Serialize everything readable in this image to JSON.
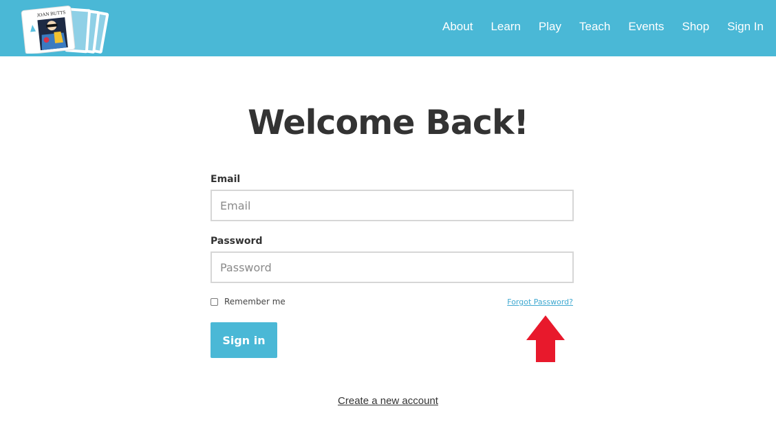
{
  "header": {
    "logo_text": "JOAN BUTTS",
    "nav": [
      "About",
      "Learn",
      "Play",
      "Teach",
      "Events",
      "Shop",
      "Sign In"
    ],
    "background_color": "#4ab8d6"
  },
  "main": {
    "title": "Welcome Back!",
    "email_label": "Email",
    "email_placeholder": "Email",
    "password_label": "Password",
    "password_placeholder": "Password",
    "remember_label": "Remember me",
    "forgot_label": "Forgot Password?",
    "signin_label": "Sign in",
    "create_account_label": "Create a new account",
    "accent_color": "#4ab8d6",
    "annotation_arrow_color": "#e8192c"
  }
}
